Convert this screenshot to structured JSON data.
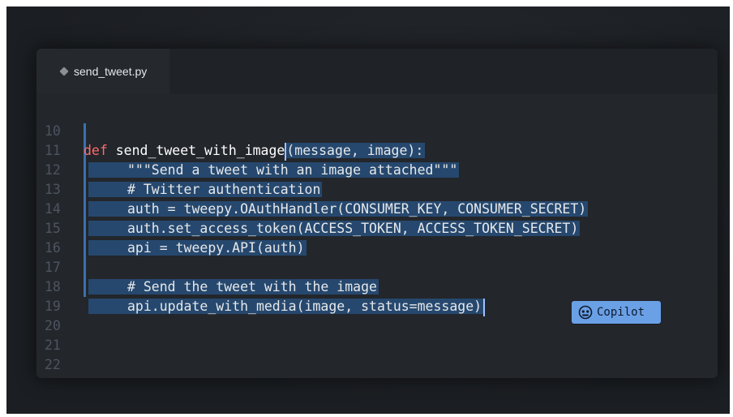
{
  "tab": {
    "filename": "send_tweet.py"
  },
  "lines": [
    {
      "num": "10",
      "kw": "def",
      "fn": "send_tweet_with_image",
      "rest": "(message, image):"
    },
    {
      "num": "11",
      "text": "\"\"\"Send a tweet with an image attached\"\"\""
    },
    {
      "num": "12",
      "text": "# Twitter authentication"
    },
    {
      "num": "13",
      "text": "auth = tweepy.OAuthHandler(CONSUMER_KEY, CONSUMER_SECRET)"
    },
    {
      "num": "14",
      "text": "auth.set_access_token(ACCESS_TOKEN, ACCESS_TOKEN_SECRET)"
    },
    {
      "num": "15",
      "text": "api = tweepy.API(auth)"
    },
    {
      "num": "16",
      "text": ""
    },
    {
      "num": "17",
      "text": "# Send the tweet with the image"
    },
    {
      "num": "18",
      "text": "api.update_with_media(image, status=message)"
    },
    {
      "num": "19",
      "text": ""
    },
    {
      "num": "20",
      "text": ""
    },
    {
      "num": "21",
      "text": ""
    },
    {
      "num": "22",
      "text": ""
    }
  ],
  "copilot": {
    "label": "Copilot",
    "icon": "copilot-icon"
  },
  "colors": {
    "keyword": "#ff6b6b",
    "selection": "#26486e",
    "copilot_badge": "#6aa0e6"
  }
}
